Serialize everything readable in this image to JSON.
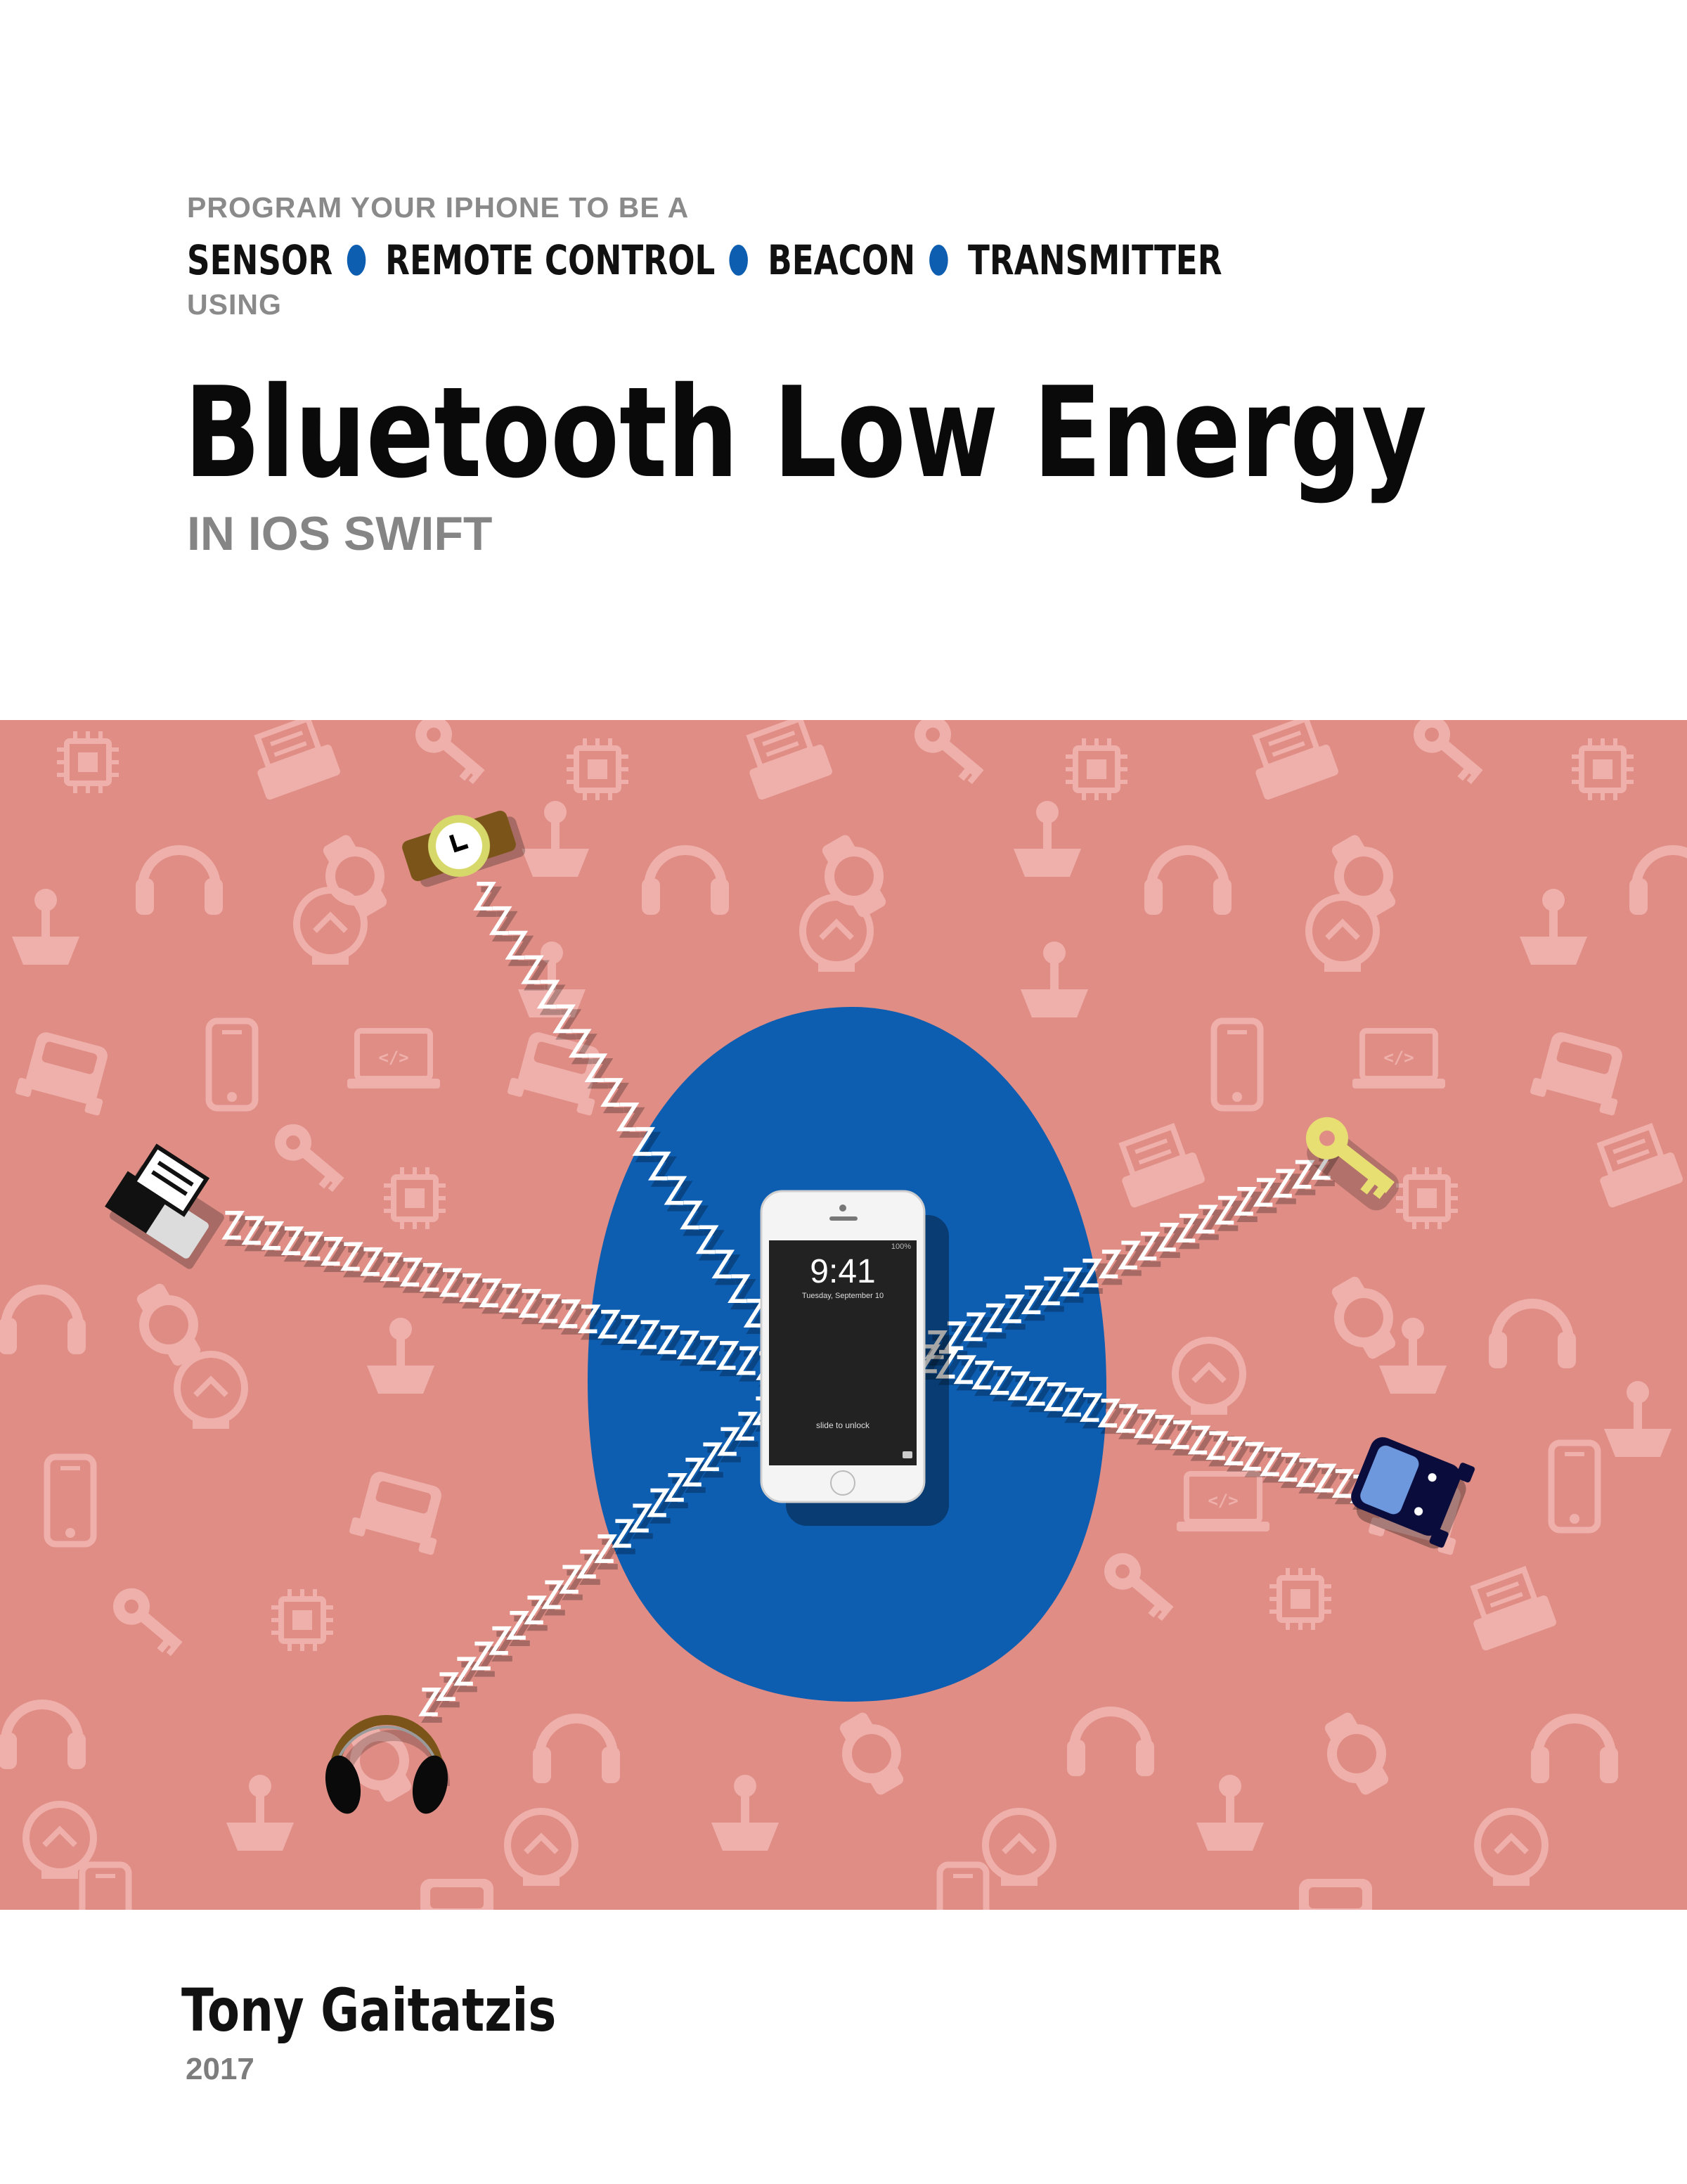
{
  "header": {
    "tagline": "PROGRAM YOUR IPHONE TO BE A",
    "roles": [
      "SENSOR",
      "REMOTE CONTROL",
      "BEACON",
      "TRANSMITTER"
    ],
    "using": "USING",
    "title": "Bluetooth Low Energy",
    "subtitle": "IN IOS SWIFT"
  },
  "phone": {
    "time": "9:41",
    "date": "Tuesday, September 10",
    "battery": "100%",
    "unlock": "slide to unlock"
  },
  "footer": {
    "author": "Tony Gaitatzis",
    "year": "2017"
  },
  "colors": {
    "accent": "#0d5db0",
    "banner": "#df8d85",
    "pattern": "#f0b3ad"
  },
  "devices": [
    "watch-icon",
    "printer-icon",
    "key-icon",
    "car-icon",
    "headphones-icon",
    "smartphone-icon"
  ]
}
